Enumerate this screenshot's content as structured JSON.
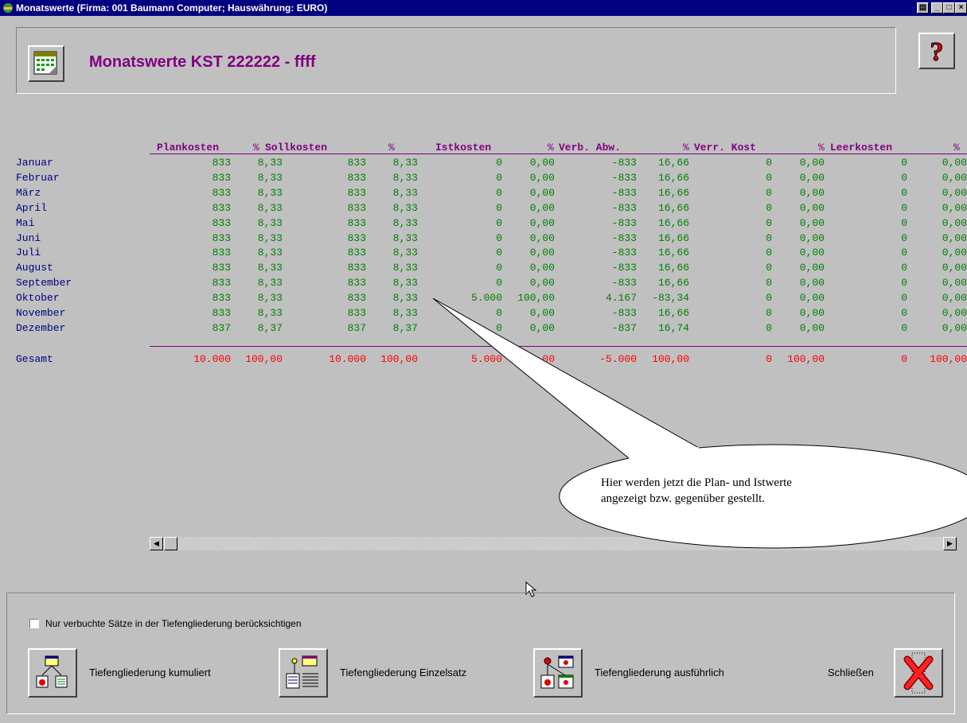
{
  "window": {
    "title": "Monatswerte  (Firma: 001 Baumann Computer;  Hauswährung: EURO)"
  },
  "header": {
    "title": "Monatswerte KST 222222 - ffff",
    "help_button": "?"
  },
  "table": {
    "columns": [
      "Plankosten",
      "%",
      "Sollkosten",
      "%",
      "Istkosten",
      "%",
      "Verb. Abw.",
      "%",
      "Verr. Kost",
      "%",
      "Leerkosten",
      "%"
    ],
    "rows": [
      {
        "month": "Januar",
        "values": [
          "833",
          "8,33",
          "833",
          "8,33",
          "0",
          "0,00",
          "-833",
          "16,66",
          "0",
          "0,00",
          "0",
          "0,00"
        ]
      },
      {
        "month": "Februar",
        "values": [
          "833",
          "8,33",
          "833",
          "8,33",
          "0",
          "0,00",
          "-833",
          "16,66",
          "0",
          "0,00",
          "0",
          "0,00"
        ]
      },
      {
        "month": "März",
        "values": [
          "833",
          "8,33",
          "833",
          "8,33",
          "0",
          "0,00",
          "-833",
          "16,66",
          "0",
          "0,00",
          "0",
          "0,00"
        ]
      },
      {
        "month": "April",
        "values": [
          "833",
          "8,33",
          "833",
          "8,33",
          "0",
          "0,00",
          "-833",
          "16,66",
          "0",
          "0,00",
          "0",
          "0,00"
        ]
      },
      {
        "month": "Mai",
        "values": [
          "833",
          "8,33",
          "833",
          "8,33",
          "0",
          "0,00",
          "-833",
          "16,66",
          "0",
          "0,00",
          "0",
          "0,00"
        ]
      },
      {
        "month": "Juni",
        "values": [
          "833",
          "8,33",
          "833",
          "8,33",
          "0",
          "0,00",
          "-833",
          "16,66",
          "0",
          "0,00",
          "0",
          "0,00"
        ]
      },
      {
        "month": "Juli",
        "values": [
          "833",
          "8,33",
          "833",
          "8,33",
          "0",
          "0,00",
          "-833",
          "16,66",
          "0",
          "0,00",
          "0",
          "0,00"
        ]
      },
      {
        "month": "August",
        "values": [
          "833",
          "8,33",
          "833",
          "8,33",
          "0",
          "0,00",
          "-833",
          "16,66",
          "0",
          "0,00",
          "0",
          "0,00"
        ]
      },
      {
        "month": "September",
        "values": [
          "833",
          "8,33",
          "833",
          "8,33",
          "0",
          "0,00",
          "-833",
          "16,66",
          "0",
          "0,00",
          "0",
          "0,00"
        ]
      },
      {
        "month": "Oktober",
        "values": [
          "833",
          "8,33",
          "833",
          "8,33",
          "5.000",
          "100,00",
          "4.167",
          "-83,34",
          "0",
          "0,00",
          "0",
          "0,00"
        ]
      },
      {
        "month": "November",
        "values": [
          "833",
          "8,33",
          "833",
          "8,33",
          "0",
          "0,00",
          "-833",
          "16,66",
          "0",
          "0,00",
          "0",
          "0,00"
        ]
      },
      {
        "month": "Dezember",
        "values": [
          "837",
          "8,37",
          "837",
          "8,37",
          "0",
          "0,00",
          "-837",
          "16,74",
          "0",
          "0,00",
          "0",
          "0,00"
        ]
      }
    ],
    "total": {
      "label": "Gesamt",
      "values": [
        "10.000",
        "100,00",
        "10.000",
        "100,00",
        "5.000",
        "100,00",
        "-5.000",
        "100,00",
        "0",
        "100,00",
        "0",
        "100,00"
      ]
    }
  },
  "callout": {
    "line1": "Hier werden jetzt die Plan- und Istwerte",
    "line2": "angezeigt bzw. gegenüber gestellt."
  },
  "options": {
    "checkbox_label": "Nur verbuchte Sätze in der Tiefengliederung berücksichtigen",
    "checked": false
  },
  "buttons": {
    "kumuliert": "Tiefengliederung kumuliert",
    "einzelsatz": "Tiefengliederung Einzelsatz",
    "ausfuehrlich": "Tiefengliederung ausführlich",
    "close": "Schließen"
  },
  "colors": {
    "title_bar": "#000080",
    "heading": "#800080",
    "values": "#008000",
    "totals": "#ff0000",
    "months": "#000080"
  }
}
